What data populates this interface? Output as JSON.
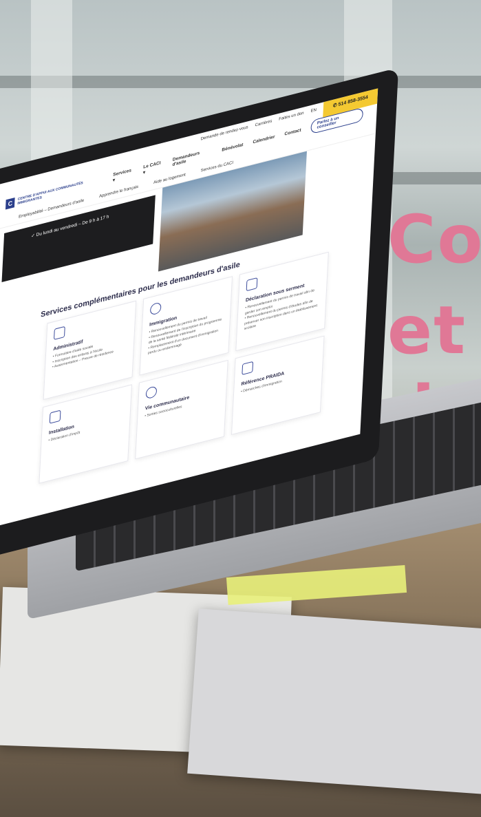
{
  "headline": {
    "line1": "Co",
    "line2": "et",
    "line3": "da"
  },
  "website": {
    "topbar": {
      "links": [
        "Demande de rendez-vous",
        "Carrières",
        "Faites un don",
        "EN"
      ],
      "phone": "514 858-3554"
    },
    "nav": {
      "logo_text": "CENTRE D'APPUI AUX COMMUNAUTÉS IMMIGRANTES",
      "logo_mark": "C",
      "items": [
        "Services ▾",
        "Le CACI ▾",
        "Demandeurs d'asile",
        "Bénévolat",
        "Calendrier",
        "Contact"
      ],
      "cta": "Parlez à un conseiller"
    },
    "subnav": [
      "Employabilité – Demandeurs d'asile",
      "Apprendre le français",
      "Aide au logement",
      "Services du CACI"
    ],
    "hero": {
      "hours": "✓  Du lundi au vendredi – De 9 h à 17 h"
    },
    "section_title": "Services complémentaires pour les demandeurs d'asile",
    "cards": [
      {
        "title": "Administratif",
        "items": [
          "• Formulaire d'aide sociale",
          "• Inscription des enfants à l'école",
          "• Assermentation – Preuve de résidence"
        ]
      },
      {
        "title": "Immigration",
        "items": [
          "• Renouvellement du permis de travail",
          "• Renouvellement de l'inscription du programme de la santé fédérale intérimaire",
          "• Remplacement d'un document d'immigration perdu ou endommagé"
        ]
      },
      {
        "title": "Déclaration sous serment",
        "items": [
          "• Renouvellement du permis de travail afin de garder son emploi",
          "• Renouvellement du permis d'études afin de préserver son inscription dans un établissement scolaire"
        ]
      },
      {
        "title": "Installation",
        "items": [
          "• Déclaration d'impôt"
        ]
      },
      {
        "title": "Vie communautaire",
        "items": [
          "• Sorties socioculturelles"
        ]
      },
      {
        "title": "Référence PRAIDA",
        "items": [
          "• Démarches d'immigration"
        ]
      }
    ]
  },
  "colors": {
    "headline": "#e07896",
    "phone_bg": "#f4c932",
    "brand": "#2b3f8c"
  }
}
